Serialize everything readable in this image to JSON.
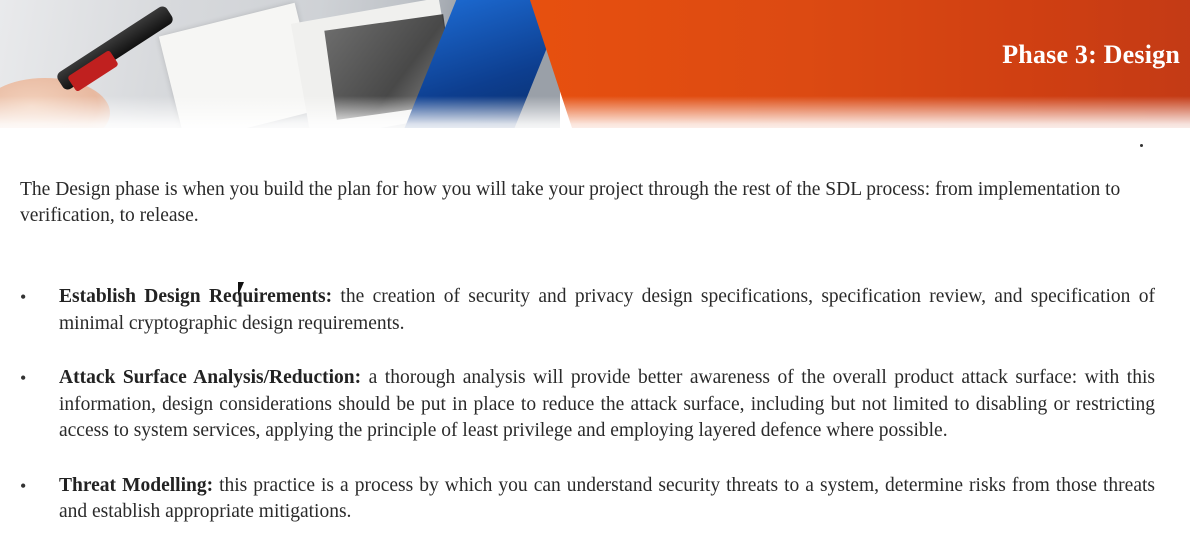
{
  "header": {
    "title": "Phase 3: Design"
  },
  "intro": "The Design phase is when you build the plan for how you will take your project through the rest of the SDL process: from implementation to verification, to release.",
  "bullets": [
    {
      "term": "Establish Design Requirements:",
      "text": " the creation of security and privacy design specifications, specification review, and specification of minimal cryptographic design requirements."
    },
    {
      "term": "Attack Surface Analysis/Reduction:",
      "text": " a thorough analysis will provide better awareness of the overall product attack surface: with this information, design considerations should be put in place to reduce the attack surface, including but not limited to disabling or restricting access to system services, applying the principle of least privilege and employing layered defence where possible."
    },
    {
      "term": "Threat Modelling:",
      "text": " this practice is a process by which you can understand security threats to a system, determine risks from those threats and establish appropriate mitigations."
    }
  ],
  "bullet_glyph": "•"
}
